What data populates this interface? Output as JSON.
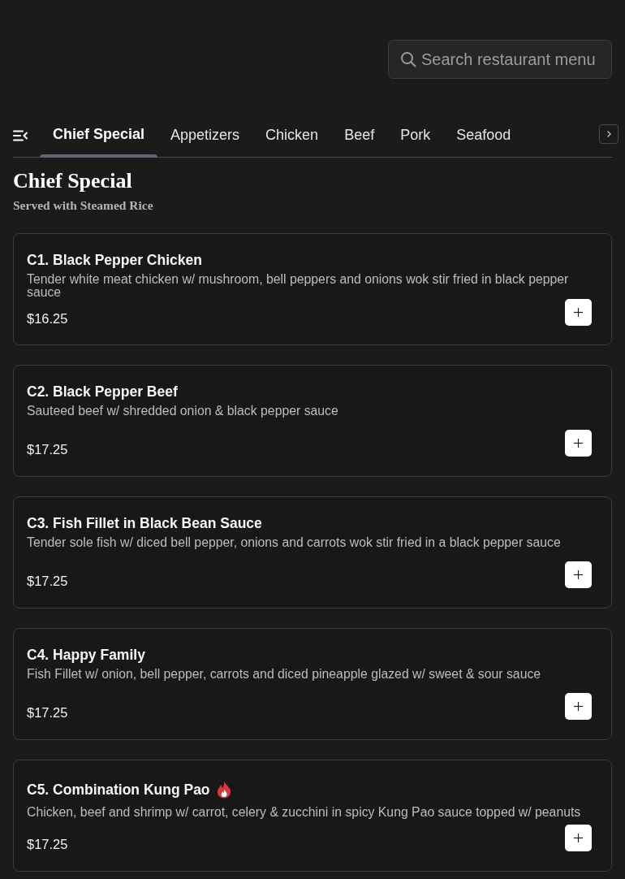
{
  "search": {
    "placeholder": "Search restaurant menu"
  },
  "tabs": [
    {
      "label": "Chief Special",
      "selected": true
    },
    {
      "label": "Appetizers",
      "selected": false
    },
    {
      "label": "Chicken",
      "selected": false
    },
    {
      "label": "Beef",
      "selected": false
    },
    {
      "label": "Pork",
      "selected": false
    },
    {
      "label": "Seafood",
      "selected": false
    }
  ],
  "section": {
    "title": "Chief Special",
    "subtitle": "Served with Steamed Rice"
  },
  "items": [
    {
      "name": "C1. Black Pepper Chicken",
      "spicy": false,
      "description": "Tender white meat chicken w/ mushroom, bell peppers and onions wok stir fried in black pepper sauce",
      "price": "$16.25"
    },
    {
      "name": "C2. Black Pepper Beef",
      "spicy": false,
      "description": "Sauteed beef w/ shredded onion & black pepper sauce",
      "price": "$17.25"
    },
    {
      "name": "C3. Fish Fillet in Black Bean Sauce",
      "spicy": false,
      "description": "Tender sole fish w/ diced bell pepper, onions and carrots wok stir fried in a black pepper sauce",
      "price": "$17.25"
    },
    {
      "name": "C4. Happy Family",
      "spicy": false,
      "description": "Fish Fillet w/ onion, bell pepper, carrots and diced pineapple glazed w/ sweet & sour sauce",
      "price": "$17.25"
    },
    {
      "name": "C5. Combination Kung Pao",
      "spicy": true,
      "description": "Chicken, beef and shrimp w/ carrot, celery & zucchini in spicy Kung Pao sauce topped w/ peanuts",
      "price": "$17.25"
    }
  ]
}
